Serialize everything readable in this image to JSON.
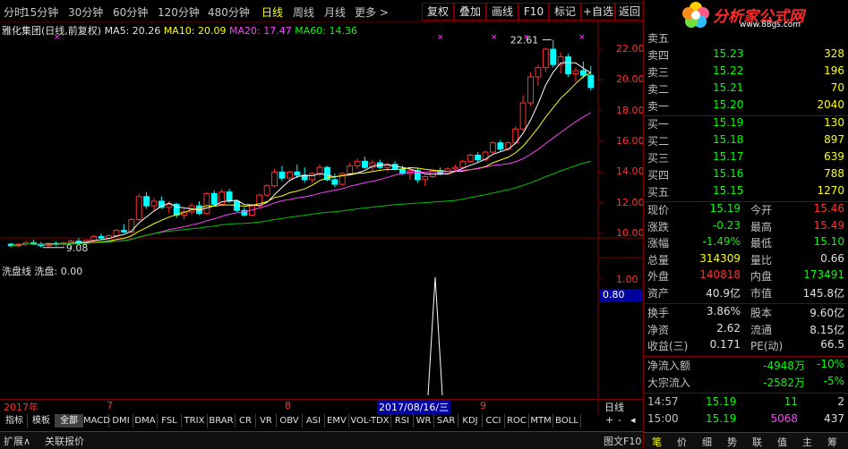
{
  "toolbar": {
    "periods": [
      "分时",
      "15分钟",
      "30分钟",
      "60分钟",
      "120分钟",
      "480分钟",
      "日线",
      "周线",
      "月线",
      "更多 >"
    ],
    "active_period": "日线",
    "buttons": [
      "复权",
      "叠加",
      "画线",
      "F10",
      "标记",
      "+自选",
      "返回"
    ]
  },
  "logo": {
    "title": "分析家公式网",
    "url": "www.88gs.com"
  },
  "chart_title": {
    "name": "雅化集团(日线,前复权)",
    "ma5": "MA5: 20.26",
    "ma10": "MA10: 20.09",
    "ma20": "MA20: 17.47",
    "ma60": "MA60: 14.36"
  },
  "chart_data": {
    "type": "candlestick",
    "y_ticks": [
      "22.00",
      "20.00",
      "18.00",
      "16.00",
      "14.00",
      "12.00",
      "10.00"
    ],
    "high_label": "22.61",
    "low_label": "9.08",
    "date_ticks": [
      "2017年",
      "7",
      "8",
      "9"
    ],
    "selected_date": "2017/08/16/三",
    "ohlc": [
      [
        9.3,
        9.4,
        9.1,
        9.2
      ],
      [
        9.2,
        9.35,
        9.1,
        9.3
      ],
      [
        9.3,
        9.5,
        9.2,
        9.4
      ],
      [
        9.4,
        9.6,
        9.25,
        9.3
      ],
      [
        9.3,
        9.45,
        9.08,
        9.2
      ],
      [
        9.2,
        9.4,
        9.1,
        9.35
      ],
      [
        9.35,
        9.5,
        9.2,
        9.3
      ],
      [
        9.3,
        9.45,
        9.15,
        9.4
      ],
      [
        9.4,
        9.6,
        9.3,
        9.5
      ],
      [
        9.5,
        9.7,
        9.35,
        9.4
      ],
      [
        9.4,
        9.6,
        9.3,
        9.55
      ],
      [
        9.55,
        9.9,
        9.45,
        9.8
      ],
      [
        9.8,
        10.0,
        9.6,
        9.7
      ],
      [
        9.7,
        9.95,
        9.6,
        9.85
      ],
      [
        9.85,
        10.3,
        9.75,
        10.2
      ],
      [
        10.2,
        10.6,
        10.0,
        10.1
      ],
      [
        10.1,
        11.0,
        10.0,
        10.9
      ],
      [
        10.9,
        12.6,
        10.8,
        12.4
      ],
      [
        12.4,
        12.7,
        11.6,
        11.8
      ],
      [
        11.8,
        12.3,
        11.5,
        12.1
      ],
      [
        12.1,
        12.4,
        11.6,
        11.7
      ],
      [
        11.7,
        12.1,
        11.3,
        11.9
      ],
      [
        11.9,
        12.0,
        11.0,
        11.2
      ],
      [
        11.2,
        11.6,
        10.9,
        11.4
      ],
      [
        11.4,
        12.0,
        11.2,
        11.8
      ],
      [
        11.8,
        12.1,
        11.2,
        11.3
      ],
      [
        11.3,
        12.7,
        11.2,
        12.6
      ],
      [
        12.6,
        12.8,
        11.8,
        11.9
      ],
      [
        11.9,
        12.9,
        11.8,
        12.7
      ],
      [
        12.7,
        12.9,
        12.0,
        12.1
      ],
      [
        12.1,
        12.2,
        11.4,
        11.5
      ],
      [
        11.5,
        11.7,
        11.1,
        11.2
      ],
      [
        11.2,
        11.9,
        11.1,
        11.8
      ],
      [
        11.8,
        12.6,
        11.7,
        12.5
      ],
      [
        12.5,
        13.2,
        12.4,
        13.1
      ],
      [
        13.1,
        14.2,
        13.0,
        14.0
      ],
      [
        14.0,
        14.4,
        13.4,
        13.6
      ],
      [
        13.6,
        14.1,
        13.4,
        14.0
      ],
      [
        14.0,
        14.5,
        13.6,
        13.8
      ],
      [
        13.8,
        14.3,
        13.3,
        13.5
      ],
      [
        13.5,
        14.0,
        13.3,
        13.9
      ],
      [
        13.9,
        14.5,
        13.7,
        14.3
      ],
      [
        14.3,
        14.4,
        13.4,
        13.5
      ],
      [
        13.5,
        13.9,
        13.0,
        13.2
      ],
      [
        13.2,
        14.0,
        13.1,
        13.9
      ],
      [
        13.9,
        14.6,
        13.8,
        14.4
      ],
      [
        14.4,
        14.9,
        14.2,
        14.7
      ],
      [
        14.7,
        15.0,
        14.2,
        14.3
      ],
      [
        14.3,
        14.8,
        14.0,
        14.6
      ],
      [
        14.6,
        14.8,
        14.2,
        14.3
      ],
      [
        14.3,
        14.6,
        14.0,
        14.5
      ],
      [
        14.5,
        14.7,
        14.1,
        14.2
      ],
      [
        14.2,
        14.4,
        13.8,
        13.9
      ],
      [
        13.9,
        14.2,
        13.5,
        14.1
      ],
      [
        14.1,
        14.3,
        13.3,
        13.5
      ],
      [
        13.5,
        13.8,
        13.1,
        13.7
      ],
      [
        13.7,
        14.2,
        13.6,
        14.1
      ],
      [
        14.1,
        14.3,
        13.8,
        13.9
      ],
      [
        13.9,
        14.3,
        13.8,
        14.2
      ],
      [
        14.2,
        14.5,
        14.0,
        14.3
      ],
      [
        14.3,
        14.8,
        14.2,
        14.7
      ],
      [
        14.7,
        15.2,
        14.6,
        15.1
      ],
      [
        15.1,
        15.3,
        14.6,
        14.8
      ],
      [
        14.8,
        15.4,
        14.7,
        15.3
      ],
      [
        15.3,
        16.0,
        15.2,
        15.9
      ],
      [
        15.9,
        16.1,
        15.3,
        15.5
      ],
      [
        15.5,
        16.0,
        15.4,
        15.9
      ],
      [
        15.9,
        17.0,
        15.8,
        16.8
      ],
      [
        16.8,
        19.0,
        16.7,
        18.5
      ],
      [
        18.5,
        20.5,
        18.3,
        20.2
      ],
      [
        20.2,
        21.0,
        19.6,
        20.8
      ],
      [
        20.8,
        22.1,
        20.5,
        22.0
      ],
      [
        22.0,
        22.61,
        20.8,
        21.0
      ],
      [
        21.0,
        21.8,
        20.4,
        21.5
      ],
      [
        21.5,
        21.7,
        20.2,
        20.4
      ],
      [
        20.4,
        20.8,
        19.9,
        20.6
      ],
      [
        20.6,
        21.2,
        20.1,
        20.3
      ],
      [
        20.3,
        20.9,
        19.3,
        19.5
      ]
    ],
    "ma_values": {
      "MA5": 20.26,
      "MA10": 20.09,
      "MA20": 17.47,
      "MA60": 14.36
    }
  },
  "indicator": {
    "title": "洗盘线 洗盘: 0.00",
    "y_ticks": [
      "1.00",
      "0.80"
    ],
    "signal_value": 1.0,
    "signal_date": "2017/08/16/三"
  },
  "panel_label": "日线",
  "indicator_tabs": [
    "指标",
    "模板",
    "全部",
    "MACD",
    "DMI",
    "DMA",
    "FSL",
    "TRIX",
    "BRAR",
    "CR",
    "VR",
    "OBV",
    "ASI",
    "EMV",
    "VOL-TDX",
    "RSI",
    "WR",
    "SAR",
    "KDJ",
    "CCI",
    "ROC",
    "MTM",
    "BOLL"
  ],
  "bottom_bar": {
    "expand": "扩展∧",
    "linked": "关联报价",
    "f10": "图文F10"
  },
  "quote": {
    "sell": [
      {
        "label": "卖五",
        "price": "",
        "vol": ""
      },
      {
        "label": "卖四",
        "price": "15.23",
        "vol": "328"
      },
      {
        "label": "卖三",
        "price": "15.22",
        "vol": "196"
      },
      {
        "label": "卖二",
        "price": "15.21",
        "vol": "70"
      },
      {
        "label": "卖一",
        "price": "15.20",
        "vol": "2040"
      }
    ],
    "buy": [
      {
        "label": "买一",
        "price": "15.19",
        "vol": "130"
      },
      {
        "label": "买二",
        "price": "15.18",
        "vol": "897"
      },
      {
        "label": "买三",
        "price": "15.17",
        "vol": "639"
      },
      {
        "label": "买四",
        "price": "15.16",
        "vol": "788"
      },
      {
        "label": "买五",
        "price": "15.15",
        "vol": "1270"
      }
    ],
    "stats": [
      {
        "l1": "现价",
        "v1": "15.19",
        "l2": "今开",
        "v2": "15.46"
      },
      {
        "l1": "涨跌",
        "v1": "-0.23",
        "l2": "最高",
        "v2": "15.49"
      },
      {
        "l1": "涨幅",
        "v1": "-1.49%",
        "l2": "最低",
        "v2": "15.10"
      },
      {
        "l1": "总量",
        "v1": "314309",
        "l2": "量比",
        "v2": "0.66"
      },
      {
        "l1": "外盘",
        "v1": "140818",
        "l2": "内盘",
        "v2": "173491"
      },
      {
        "l1": "资产",
        "v1": "40.9亿",
        "l2": "市值",
        "v2": "145.8亿"
      }
    ],
    "stats2": [
      {
        "l1": "换手",
        "v1": "3.86%",
        "l2": "股本",
        "v2": "9.60亿"
      },
      {
        "l1": "净资",
        "v1": "2.62",
        "l2": "流通",
        "v2": "8.15亿"
      },
      {
        "l1": "收益(三)",
        "v1": "0.171",
        "l2": "PE(动)",
        "v2": "66.5"
      }
    ],
    "flows": [
      {
        "l": "净流入额",
        "v": "-4948万",
        "p": "-10%"
      },
      {
        "l": "大宗流入",
        "v": "-2582万",
        "p": "-5%"
      }
    ],
    "ticks": [
      {
        "time": "14:57",
        "price": "15.19",
        "vol": "11",
        "n": "2"
      },
      {
        "time": "15:00",
        "price": "15.19",
        "vol": "5068",
        "n": "437"
      }
    ],
    "bottom_tabs": [
      "笔",
      "价",
      "细",
      "势",
      "联",
      "值",
      "主",
      "筹"
    ]
  }
}
